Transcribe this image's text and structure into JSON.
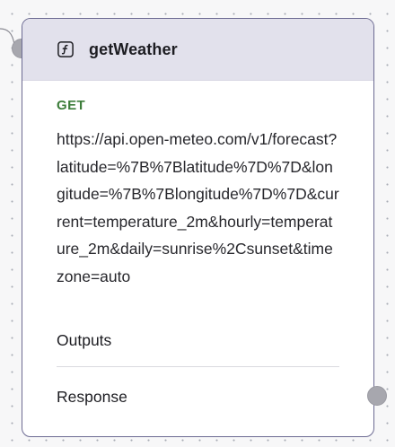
{
  "node": {
    "title": "getWeather",
    "icon": "function-icon",
    "method": "GET",
    "url": "https://api.open-meteo.com/v1/forecast?latitude=%7B%7Blatitude%7D%7D&longitude=%7B%7Blongitude%7D%7D&current=temperature_2m&hourly=temperature_2m&daily=sunrise%2Csunset&timezone=auto",
    "sections": {
      "outputs": "Outputs",
      "response": "Response"
    }
  },
  "colors": {
    "border": "#6c6a92",
    "header_bg": "#e2e1ec",
    "method_green": "#3c7d3a",
    "connector": "#a7a7ae"
  }
}
